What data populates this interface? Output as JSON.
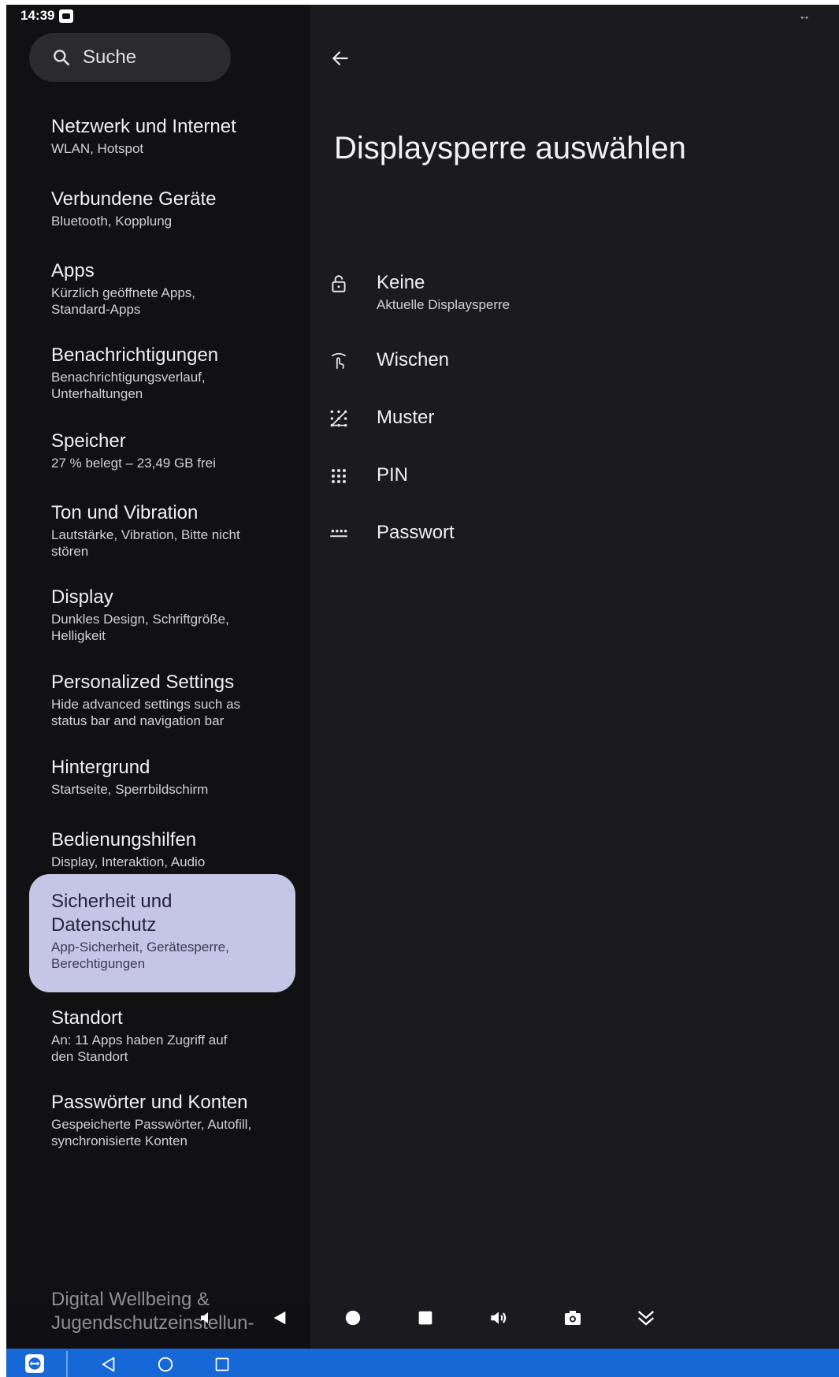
{
  "status_bar": {
    "time": "14:39"
  },
  "search": {
    "label": "Suche"
  },
  "settings": [
    {
      "title": "Netzwerk und Internet",
      "subtitle": "WLAN, Hotspot"
    },
    {
      "title": "Verbundene Geräte",
      "subtitle": "Bluetooth, Kopplung"
    },
    {
      "title": "Apps",
      "subtitle": "Kürzlich geöffnete Apps, Standard-Apps"
    },
    {
      "title": "Benachrichtigungen",
      "subtitle": "Benachrichtigungsverlauf, Unterhaltungen"
    },
    {
      "title": "Speicher",
      "subtitle": "27 % belegt – 23,49 GB frei"
    },
    {
      "title": "Ton und Vibration",
      "subtitle": "Lautstärke, Vibration, Bitte nicht stören"
    },
    {
      "title": "Display",
      "subtitle": "Dunkles Design, Schriftgröße, Helligkeit"
    },
    {
      "title": "Personalized Settings",
      "subtitle": "Hide advanced settings such as status bar and navigation bar"
    },
    {
      "title": "Hintergrund",
      "subtitle": "Startseite, Sperrbildschirm"
    },
    {
      "title": "Bedienungshilfen",
      "subtitle": "Display, Interaktion, Audio"
    },
    {
      "title": "Sicherheit und Datenschutz",
      "subtitle": "App-Sicherheit, Gerätesperre, Berechtigungen"
    },
    {
      "title": "Standort",
      "subtitle": "An: 11 Apps haben Zugriff auf den Standort"
    },
    {
      "title": "Passwörter und Konten",
      "subtitle": "Gespeicherte Passwörter, Autofill, synchronisierte Konten"
    },
    {
      "title": "Digital Wellbeing & Jugendschutzeinstellun-"
    }
  ],
  "detail": {
    "title": "Displaysperre auswählen",
    "options": [
      {
        "label": "Keine",
        "subtitle": "Aktuelle Displaysperre",
        "icon": "lock-open-icon"
      },
      {
        "label": "Wischen",
        "icon": "swipe-icon"
      },
      {
        "label": "Muster",
        "icon": "pattern-icon"
      },
      {
        "label": "PIN",
        "icon": "pin-dots-icon"
      },
      {
        "label": "Passwort",
        "icon": "password-icon"
      }
    ]
  },
  "colors": {
    "sidebar_bg": "#111114",
    "detail_bg": "#1b1b1f",
    "selected_bg": "#c5c5e6",
    "taskbar": "#1568d6"
  }
}
